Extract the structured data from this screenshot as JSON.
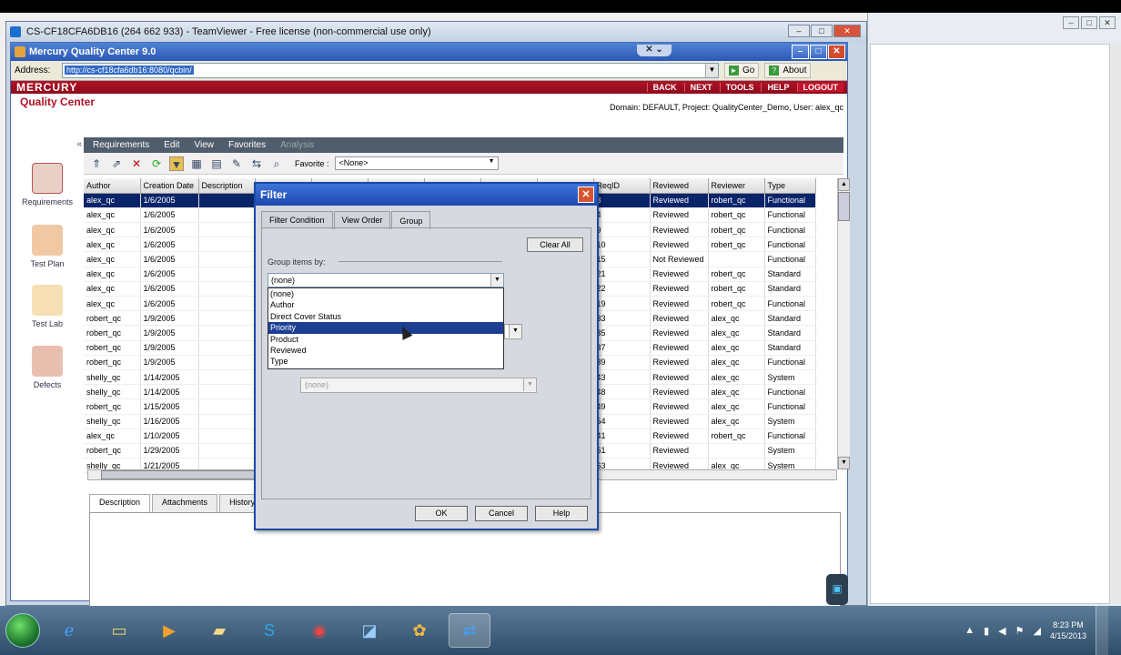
{
  "teamviewer": {
    "title": "CS-CF18CFA6DB16 (264 662 933) - TeamViewer - Free license (non-commercial use only)"
  },
  "ie": {
    "title": "Mercury Quality Center 9.0",
    "address_label": "Address:",
    "address_value": "http://cs-cf18cfa6db16:8080/qcbin/",
    "go_label": "Go",
    "about_label": "About"
  },
  "mercury": {
    "brand": "MERCURY",
    "product": "Quality Center",
    "nav_buttons": [
      "BACK",
      "NEXT",
      "TOOLS",
      "HELP",
      "LOGOUT"
    ],
    "domain_info": "Domain: DEFAULT, Project: QualityCenter_Demo, User: alex_qc"
  },
  "sidebar": {
    "items": [
      {
        "label": "Requirements",
        "icon": "requirements-icon",
        "color": "#c0392b"
      },
      {
        "label": "Test Plan",
        "icon": "test-plan-icon",
        "color": "#d35400"
      },
      {
        "label": "Test Lab",
        "icon": "test-lab-icon",
        "color": "#e67e22"
      },
      {
        "label": "Defects",
        "icon": "defects-icon",
        "color": "#c0392b"
      }
    ]
  },
  "menu": {
    "items": [
      "Requirements",
      "Edit",
      "View",
      "Favorites"
    ],
    "disabled": "Analysis"
  },
  "toolbar": {
    "favorite_label": "Favorite :",
    "favorite_value": "<None>"
  },
  "grid": {
    "columns": [
      "Author",
      "Creation Date",
      "Description",
      "",
      "",
      "",
      "",
      "",
      "",
      "ReqID",
      "Reviewed",
      "Reviewer",
      "Type"
    ],
    "rows": [
      [
        "alex_qc",
        "1/6/2005",
        "3",
        "Reviewed",
        "robert_qc",
        "Functional"
      ],
      [
        "alex_qc",
        "1/6/2005",
        "4",
        "Reviewed",
        "robert_qc",
        "Functional"
      ],
      [
        "alex_qc",
        "1/6/2005",
        "9",
        "Reviewed",
        "robert_qc",
        "Functional"
      ],
      [
        "alex_qc",
        "1/6/2005",
        "10",
        "Reviewed",
        "robert_qc",
        "Functional"
      ],
      [
        "alex_qc",
        "1/6/2005",
        "15",
        "Not Reviewed",
        "",
        "Functional"
      ],
      [
        "alex_qc",
        "1/6/2005",
        "21",
        "Reviewed",
        "robert_qc",
        "Standard"
      ],
      [
        "alex_qc",
        "1/6/2005",
        "22",
        "Reviewed",
        "robert_qc",
        "Standard"
      ],
      [
        "alex_qc",
        "1/6/2005",
        "19",
        "Reviewed",
        "robert_qc",
        "Functional"
      ],
      [
        "robert_qc",
        "1/9/2005",
        "33",
        "Reviewed",
        "alex_qc",
        "Standard"
      ],
      [
        "robert_qc",
        "1/9/2005",
        "35",
        "Reviewed",
        "alex_qc",
        "Standard"
      ],
      [
        "robert_qc",
        "1/9/2005",
        "37",
        "Reviewed",
        "alex_qc",
        "Standard"
      ],
      [
        "robert_qc",
        "1/9/2005",
        "39",
        "Reviewed",
        "alex_qc",
        "Functional"
      ],
      [
        "shelly_qc",
        "1/14/2005",
        "43",
        "Reviewed",
        "alex_qc",
        "System"
      ],
      [
        "shelly_qc",
        "1/14/2005",
        "48",
        "Reviewed",
        "alex_qc",
        "Functional"
      ],
      [
        "robert_qc",
        "1/15/2005",
        "49",
        "Reviewed",
        "alex_qc",
        "Functional"
      ],
      [
        "shelly_qc",
        "1/16/2005",
        "54",
        "Reviewed",
        "alex_qc",
        "System"
      ],
      [
        "alex_qc",
        "1/10/2005",
        "41",
        "Reviewed",
        "robert_qc",
        "Functional"
      ],
      [
        "robert_qc",
        "1/29/2005",
        "61",
        "Reviewed",
        "",
        "System"
      ],
      [
        "shelly_qc",
        "1/21/2005",
        "63",
        "Reviewed",
        "alex_qc",
        "System"
      ]
    ]
  },
  "bottom_tabs": [
    "Description",
    "Attachments",
    "History"
  ],
  "filter_dialog": {
    "title": "Filter",
    "tabs": [
      "Filter Condition",
      "View Order",
      "Group"
    ],
    "clear_all": "Clear All",
    "group_label": "Group items by:",
    "group_selected": "(none)",
    "options": [
      "(none)",
      "Author",
      "Direct Cover Status",
      "Priority",
      "Product",
      "Reviewed",
      "Type"
    ],
    "highlighted": "Priority",
    "second_select": "(none)",
    "buttons": [
      "OK",
      "Cancel",
      "Help"
    ]
  },
  "taskbar": {
    "apps": [
      "ie-icon",
      "explorer-icon",
      "media-player-icon",
      "folder-icon",
      "skype-icon",
      "chrome-icon",
      "app-icon",
      "flower-icon",
      "teamviewer-icon"
    ],
    "time": "8:23 PM",
    "date": "4/15/2013"
  }
}
